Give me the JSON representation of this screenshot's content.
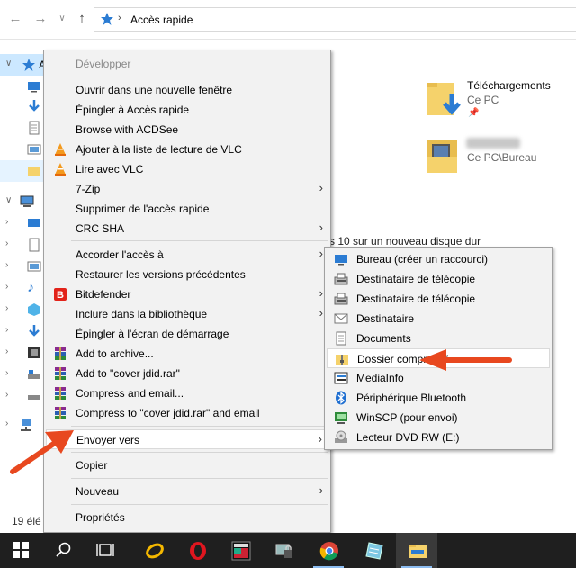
{
  "address_bar": {
    "path": "Accès rapide"
  },
  "nav_pane": {
    "quick_access_label": "A",
    "status": "19 élé"
  },
  "content": {
    "tiles": [
      {
        "title": "Téléchargements",
        "subtitle": "Ce PC"
      },
      {
        "title": "",
        "subtitle": "Ce PC\\Bureau"
      }
    ],
    "background_text": "s 10 sur un nouveau disque dur"
  },
  "context_menu": {
    "items": [
      {
        "label": "Développer"
      },
      {
        "label": "Ouvrir dans une nouvelle fenêtre"
      },
      {
        "label": "Épingler à Accès rapide"
      },
      {
        "label": "Browse with ACDSee"
      },
      {
        "label": "Ajouter à la liste de lecture de VLC"
      },
      {
        "label": "Lire avec VLC"
      },
      {
        "label": "7-Zip"
      },
      {
        "label": "Supprimer de l'accès rapide"
      },
      {
        "label": "CRC SHA"
      },
      {
        "label": "Accorder l'accès à"
      },
      {
        "label": "Restaurer les versions précédentes"
      },
      {
        "label": "Bitdefender"
      },
      {
        "label": "Inclure dans la bibliothèque"
      },
      {
        "label": "Épingler à l'écran de démarrage"
      },
      {
        "label": "Add to archive..."
      },
      {
        "label": "Add to \"cover jdid.rar\""
      },
      {
        "label": "Compress and email..."
      },
      {
        "label": "Compress to \"cover jdid.rar\" and email"
      },
      {
        "label": "Envoyer vers"
      },
      {
        "label": "Copier"
      },
      {
        "label": "Nouveau"
      },
      {
        "label": "Propriétés"
      }
    ]
  },
  "send_to_menu": {
    "items": [
      {
        "label": "Bureau (créer un raccourci)"
      },
      {
        "label": "Destinataire de télécopie"
      },
      {
        "label": "Destinataire de télécopie"
      },
      {
        "label": "Destinataire"
      },
      {
        "label": "Documents"
      },
      {
        "label": "Dossier compressé"
      },
      {
        "label": "MediaInfo"
      },
      {
        "label": "Périphérique Bluetooth"
      },
      {
        "label": "WinSCP (pour envoi)"
      },
      {
        "label": "Lecteur DVD RW (E:)"
      }
    ]
  },
  "colors": {
    "accent": "#0078d7",
    "arrow": "#e8481f",
    "taskbar": "#1f1f1f"
  }
}
